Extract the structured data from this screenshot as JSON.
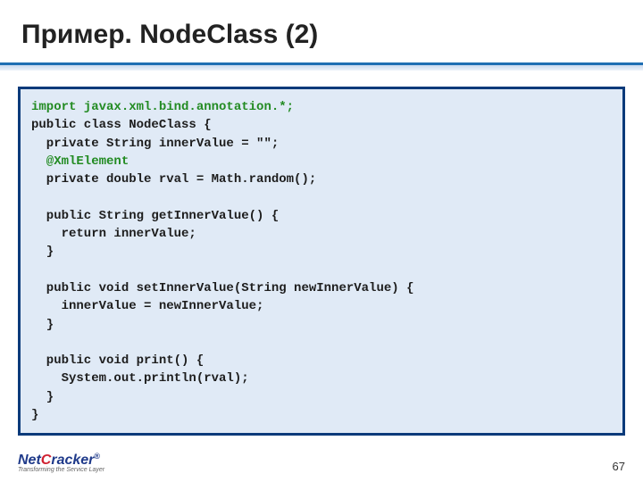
{
  "title": "Пример. NodeClass (2)",
  "code": {
    "l1": "import javax.xml.bind.annotation.*;",
    "l2": "public class NodeClass {",
    "l3": "  private String innerValue = \"\";",
    "l4": "  @XmlElement",
    "l5": "  private double rval = Math.random();",
    "l6": "",
    "l7": "  public String getInnerValue() {",
    "l8": "    return innerValue;",
    "l9": "  }",
    "l10": "",
    "l11": "  public void setInnerValue(String newInnerValue) {",
    "l12": "    innerValue = newInnerValue;",
    "l13": "  }",
    "l14": "",
    "l15": "  public void print() {",
    "l16": "    System.out.println(rval);",
    "l17": "  }",
    "l18": "}"
  },
  "logo": {
    "net": "Net",
    "c": "C",
    "racker": "racker",
    "reg": "®",
    "tagline": "Transforming the Service Layer"
  },
  "page_number": "67"
}
